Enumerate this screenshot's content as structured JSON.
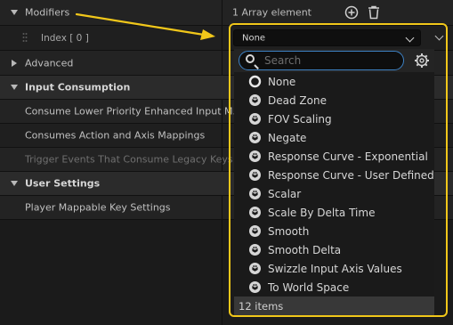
{
  "details": {
    "modifiers": {
      "label": "Modifiers",
      "value": "1 Array element"
    },
    "index": {
      "label": "Index [ 0 ]",
      "selected": "None"
    },
    "advanced": {
      "label": "Advanced"
    },
    "input_consumption": {
      "label": "Input Consumption",
      "rows": [
        {
          "label": "Consume Lower Priority Enhanced Input M...",
          "disabled": false
        },
        {
          "label": "Consumes Action and Axis Mappings",
          "disabled": false
        },
        {
          "label": "Trigger Events That Consume Legacy Keys",
          "disabled": true
        }
      ]
    },
    "user_settings": {
      "label": "User Settings",
      "rows": [
        {
          "label": "Player Mappable Key Settings"
        }
      ]
    }
  },
  "dropdown": {
    "search_placeholder": "Search",
    "items": [
      {
        "label": "None",
        "icon": "circle-icon"
      },
      {
        "label": "Dead Zone",
        "icon": "class-icon"
      },
      {
        "label": "FOV Scaling",
        "icon": "class-icon"
      },
      {
        "label": "Negate",
        "icon": "class-icon"
      },
      {
        "label": "Response Curve - Exponential",
        "icon": "class-icon"
      },
      {
        "label": "Response Curve - User Defined",
        "icon": "class-icon"
      },
      {
        "label": "Scalar",
        "icon": "class-icon"
      },
      {
        "label": "Scale By Delta Time",
        "icon": "class-icon"
      },
      {
        "label": "Smooth",
        "icon": "class-icon"
      },
      {
        "label": "Smooth Delta",
        "icon": "class-icon"
      },
      {
        "label": "Swizzle Input Axis Values",
        "icon": "class-icon"
      },
      {
        "label": "To World Space",
        "icon": "class-icon"
      }
    ],
    "footer": "12 items"
  },
  "colors": {
    "highlight": "#f1c71a",
    "search_border": "#3d82c5",
    "arrow": "#f1c71a"
  }
}
